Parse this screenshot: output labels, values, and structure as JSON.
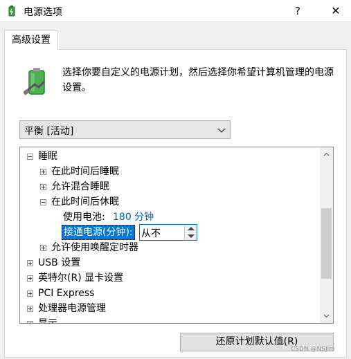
{
  "window": {
    "title": "电源选项",
    "help_label": "?",
    "close_label": "✕"
  },
  "tabs": [
    {
      "label": "高级设置",
      "active": true
    }
  ],
  "description": "选择你要自定义的电源计划，然后选择你希望计算机管理的电源设置。",
  "plan_select": {
    "value": "平衡 [活动]"
  },
  "tree": {
    "items": [
      {
        "label": "睡眠",
        "expanded": true
      },
      {
        "label": "在此时间后睡眠",
        "expanded": false
      },
      {
        "label": "允许混合睡眠",
        "expanded": false
      },
      {
        "label": "在此时间后休眠",
        "expanded": true
      },
      {
        "label": "使用电池:",
        "value": "180 分钟"
      },
      {
        "label": "接通电源(分钟):",
        "value": "从不"
      },
      {
        "label": "允许使用唤醒定时器",
        "expanded": false
      },
      {
        "label": "USB 设置",
        "expanded": false
      },
      {
        "label": "英特尔(R) 显卡设置",
        "expanded": false
      },
      {
        "label": "PCI Express",
        "expanded": false
      },
      {
        "label": "处理器电源管理",
        "expanded": false
      },
      {
        "label": "显示",
        "expanded": false
      }
    ]
  },
  "restore_button": {
    "label": "还原计划默认值(R)"
  },
  "watermark": "CSDN @NSJim",
  "colors": {
    "selection": "#0078d7",
    "value_text": "#0063b1"
  }
}
